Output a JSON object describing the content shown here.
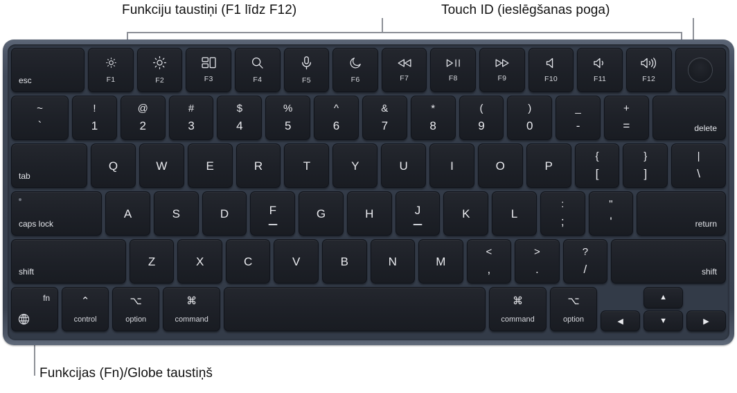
{
  "callouts": {
    "function_keys": "Funkciju taustiņi (F1 līdz F12)",
    "touch_id": "Touch ID (ieslēgšanas poga)",
    "globe_key": "Funkcijas (Fn)/Globe taustiņš"
  },
  "colors": {
    "chassis": "#3b4351",
    "chassis_inner": "#333b48",
    "key": "#1d2027",
    "key_text": "#e9eaee",
    "callout_line": "#8c8f96",
    "page_bg": "#ffffff"
  },
  "keyboard": {
    "rows": {
      "function": [
        {
          "name": "esc",
          "label": "esc",
          "icon": null,
          "fn": null
        },
        {
          "name": "f1",
          "label": null,
          "icon": "brightness-down",
          "fn": "F1"
        },
        {
          "name": "f2",
          "label": null,
          "icon": "brightness-up",
          "fn": "F2"
        },
        {
          "name": "f3",
          "label": null,
          "icon": "mission-control",
          "fn": "F3"
        },
        {
          "name": "f4",
          "label": null,
          "icon": "spotlight-search",
          "fn": "F4"
        },
        {
          "name": "f5",
          "label": null,
          "icon": "dictation-mic",
          "fn": "F5"
        },
        {
          "name": "f6",
          "label": null,
          "icon": "do-not-disturb-moon",
          "fn": "F6"
        },
        {
          "name": "f7",
          "label": null,
          "icon": "rewind",
          "fn": "F7"
        },
        {
          "name": "f8",
          "label": null,
          "icon": "play-pause",
          "fn": "F8"
        },
        {
          "name": "f9",
          "label": null,
          "icon": "fast-forward",
          "fn": "F9"
        },
        {
          "name": "f10",
          "label": null,
          "icon": "mute",
          "fn": "F10"
        },
        {
          "name": "f11",
          "label": null,
          "icon": "volume-down",
          "fn": "F11"
        },
        {
          "name": "f12",
          "label": null,
          "icon": "volume-up",
          "fn": "F12"
        },
        {
          "name": "touch-id",
          "label": null,
          "icon": "touch-id",
          "fn": null
        }
      ],
      "number": [
        {
          "name": "grave",
          "top": "~",
          "bottom": "`"
        },
        {
          "name": "one",
          "top": "!",
          "bottom": "1"
        },
        {
          "name": "two",
          "top": "@",
          "bottom": "2"
        },
        {
          "name": "three",
          "top": "#",
          "bottom": "3"
        },
        {
          "name": "four",
          "top": "$",
          "bottom": "4"
        },
        {
          "name": "five",
          "top": "%",
          "bottom": "5"
        },
        {
          "name": "six",
          "top": "^",
          "bottom": "6"
        },
        {
          "name": "seven",
          "top": "&",
          "bottom": "7"
        },
        {
          "name": "eight",
          "top": "*",
          "bottom": "8"
        },
        {
          "name": "nine",
          "top": "(",
          "bottom": "9"
        },
        {
          "name": "zero",
          "top": ")",
          "bottom": "0"
        },
        {
          "name": "minus",
          "top": "_",
          "bottom": "-"
        },
        {
          "name": "equal",
          "top": "+",
          "bottom": "="
        },
        {
          "name": "delete",
          "label": "delete"
        }
      ],
      "qwerty": [
        {
          "name": "tab",
          "label": "tab"
        },
        {
          "name": "q",
          "glyph": "Q"
        },
        {
          "name": "w",
          "glyph": "W"
        },
        {
          "name": "e",
          "glyph": "E"
        },
        {
          "name": "r",
          "glyph": "R"
        },
        {
          "name": "t",
          "glyph": "T"
        },
        {
          "name": "y",
          "glyph": "Y"
        },
        {
          "name": "u",
          "glyph": "U"
        },
        {
          "name": "i",
          "glyph": "I"
        },
        {
          "name": "o",
          "glyph": "O"
        },
        {
          "name": "p",
          "glyph": "P"
        },
        {
          "name": "bracket-left",
          "top": "{",
          "bottom": "["
        },
        {
          "name": "bracket-right",
          "top": "}",
          "bottom": "]"
        },
        {
          "name": "backslash",
          "top": "|",
          "bottom": "\\"
        }
      ],
      "home": [
        {
          "name": "caps-lock",
          "label": "caps lock"
        },
        {
          "name": "a",
          "glyph": "A"
        },
        {
          "name": "s",
          "glyph": "S"
        },
        {
          "name": "d",
          "glyph": "D"
        },
        {
          "name": "f",
          "glyph": "F",
          "homing": true
        },
        {
          "name": "g",
          "glyph": "G"
        },
        {
          "name": "h",
          "glyph": "H"
        },
        {
          "name": "j",
          "glyph": "J",
          "homing": true
        },
        {
          "name": "k",
          "glyph": "K"
        },
        {
          "name": "l",
          "glyph": "L"
        },
        {
          "name": "semicolon",
          "top": ":",
          "bottom": ";"
        },
        {
          "name": "quote",
          "top": "\"",
          "bottom": "'"
        },
        {
          "name": "return",
          "label": "return"
        }
      ],
      "shift": [
        {
          "name": "shift-left",
          "label": "shift"
        },
        {
          "name": "z",
          "glyph": "Z"
        },
        {
          "name": "x",
          "glyph": "X"
        },
        {
          "name": "c",
          "glyph": "C"
        },
        {
          "name": "v",
          "glyph": "V"
        },
        {
          "name": "b",
          "glyph": "B"
        },
        {
          "name": "n",
          "glyph": "N"
        },
        {
          "name": "m",
          "glyph": "M"
        },
        {
          "name": "comma",
          "top": "<",
          "bottom": ","
        },
        {
          "name": "period",
          "top": ">",
          "bottom": "."
        },
        {
          "name": "slash",
          "top": "?",
          "bottom": "/"
        },
        {
          "name": "shift-right",
          "label": "shift"
        }
      ],
      "modifier": {
        "fn_label": "fn",
        "control_symbol": "⌃",
        "control_label": "control",
        "option_symbol": "⌥",
        "option_label": "option",
        "command_symbol": "⌘",
        "command_label": "command",
        "right_command_symbol": "⌘",
        "right_command_label": "command",
        "right_option_symbol": "⌥",
        "right_option_label": "option",
        "arrow_left": "◀",
        "arrow_right": "▶",
        "arrow_up": "▲",
        "arrow_down": "▼",
        "space_label": ""
      }
    }
  }
}
